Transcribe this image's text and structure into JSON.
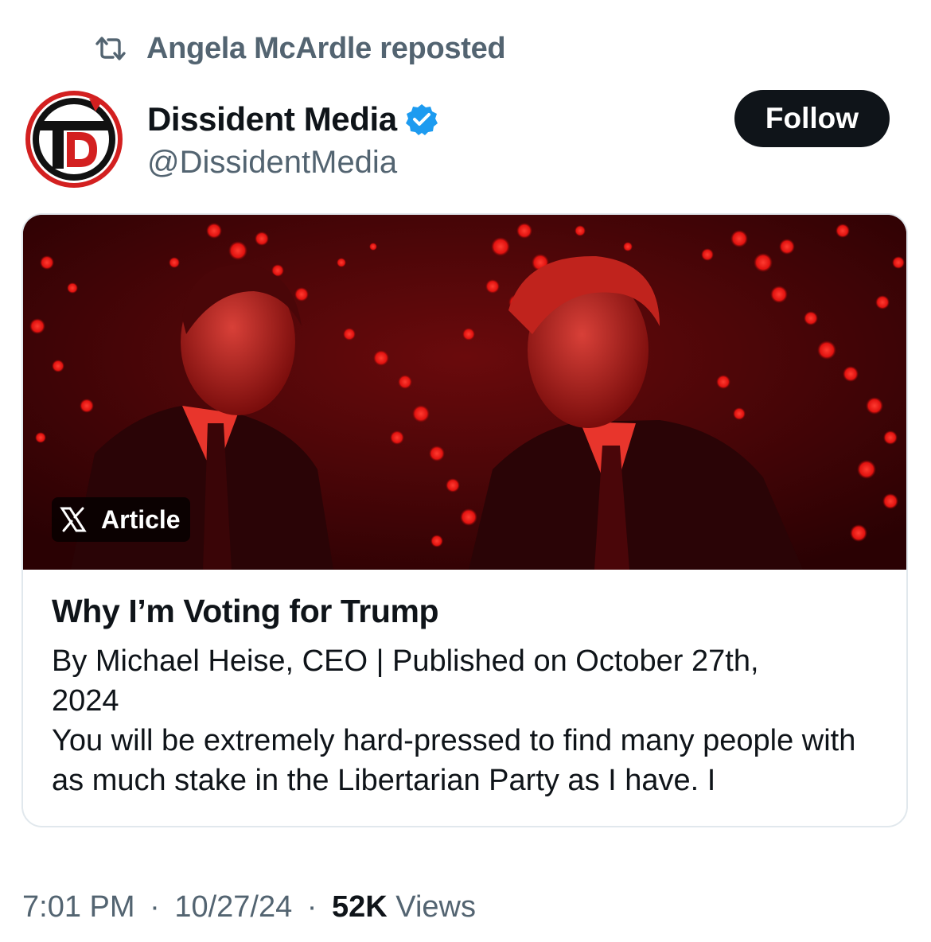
{
  "repost": {
    "icon": "repost-icon",
    "text": "Angela McArdle reposted"
  },
  "author": {
    "avatar_icon": "dissident-media-logo",
    "avatar_letter": "D",
    "name": "Dissident Media",
    "verified_icon": "verified-badge-icon",
    "handle": "@DissidentMedia"
  },
  "follow_button": {
    "label": "Follow"
  },
  "card": {
    "badge_icon": "x-logo-icon",
    "badge_label": "Article",
    "title": "Why I’m Voting for Trump",
    "byline": "By Michael Heise, CEO | Published on October 27th, 2024",
    "snippet": "You will be extremely hard-pressed to find many people with as much stake in the Libertarian Party as I have. I"
  },
  "meta": {
    "time": "7:01 PM",
    "date": "10/27/24",
    "separator": "·",
    "views_count": "52K",
    "views_label": "Views"
  },
  "colors": {
    "text_primary": "#0f1419",
    "text_secondary": "#536471",
    "verified_blue": "#1d9bf0",
    "follow_bg": "#0f1419",
    "image_red": "#e01010"
  }
}
